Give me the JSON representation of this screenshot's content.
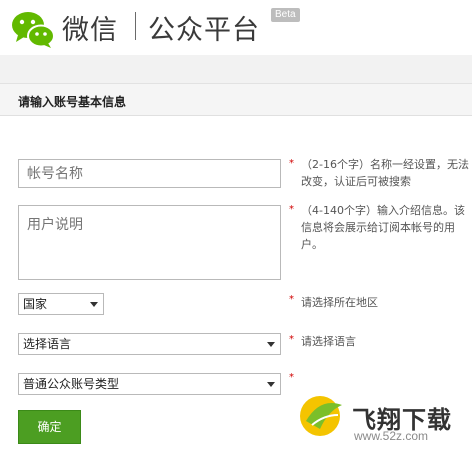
{
  "header": {
    "brand_wechat": "微信",
    "brand_platform": "公众平台",
    "beta_badge": "Beta"
  },
  "panel": {
    "title": "请输入账号基本信息"
  },
  "form": {
    "name_placeholder": "帐号名称",
    "description_placeholder": "用户说明",
    "country_select": "国家",
    "language_select": "选择语言",
    "type_select": "普通公众账号类型",
    "required_mark": "*",
    "submit_label": "确定"
  },
  "hints": {
    "name": "（2-16个字）名称一经设置，无法改变，认证后可被搜索",
    "description": "（4-140个字）输入介绍信息。该信息将会展示给订阅本帐号的用户。",
    "region": "请选择所在地区",
    "language": "请选择语言"
  },
  "watermark": {
    "text": "飞翔下载",
    "url": "www.52z.com"
  },
  "colors": {
    "wechat_green": "#62b900",
    "button_green": "#4c9e22",
    "required_red": "#d00000"
  }
}
